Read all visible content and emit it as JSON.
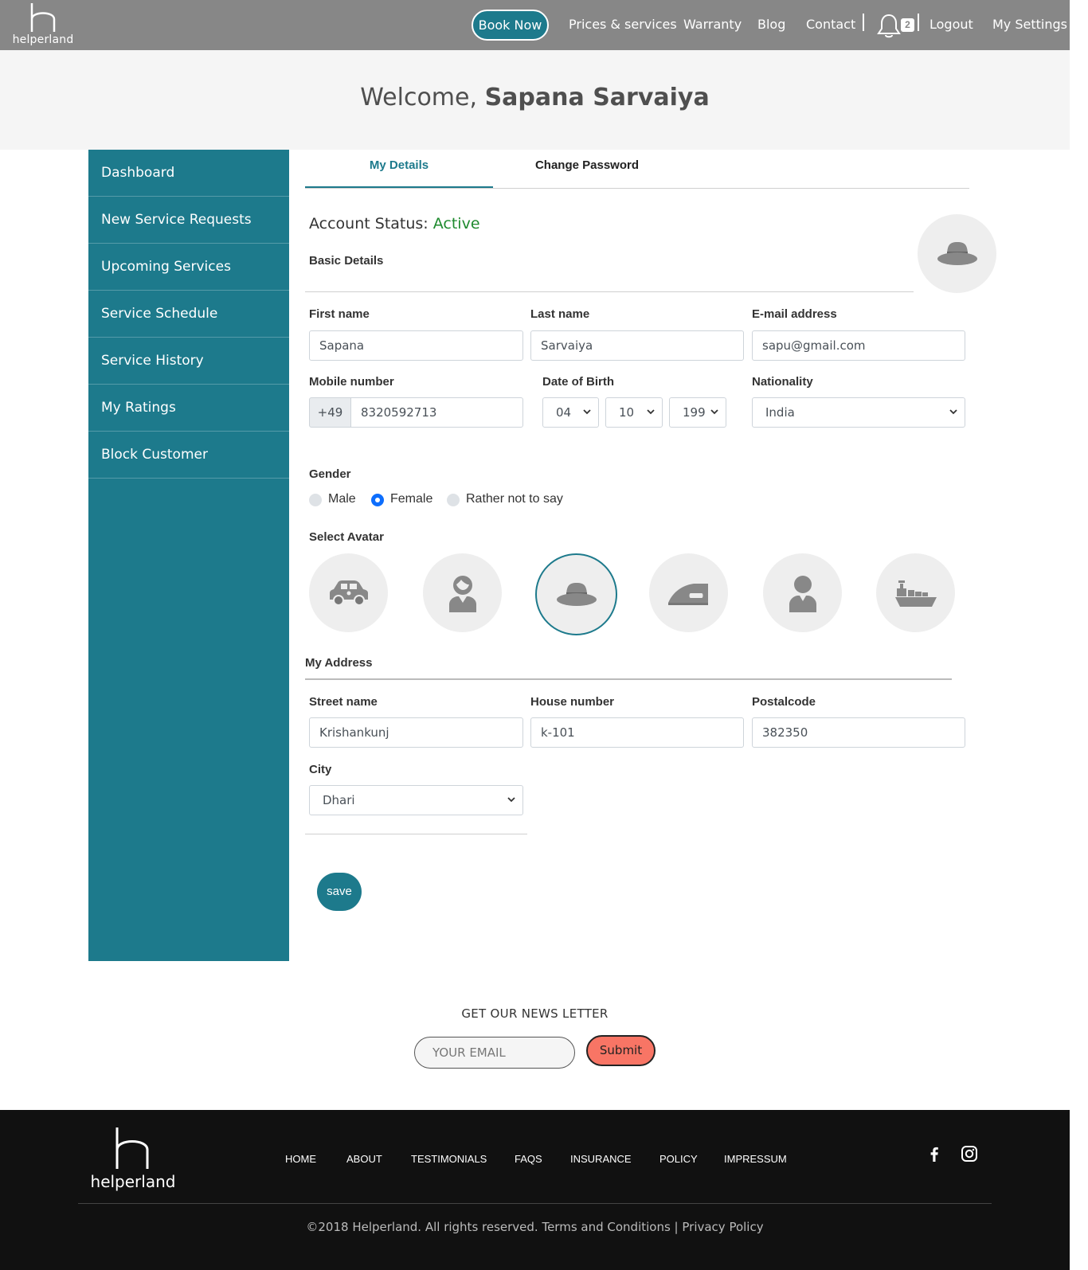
{
  "navbar": {
    "logo_text": "helperland",
    "book_now": "Book Now",
    "links": [
      "Prices & services",
      "Warranty",
      "Blog",
      "Contact"
    ],
    "notification_count": "2",
    "logout": "Logout",
    "settings": "My Settings"
  },
  "welcome": {
    "prefix": "Welcome, ",
    "name": "Sapana Sarvaiya"
  },
  "sidebar": {
    "items": [
      {
        "label": "Dashboard"
      },
      {
        "label": "New Service Requests"
      },
      {
        "label": "Upcoming Services"
      },
      {
        "label": "Service Schedule"
      },
      {
        "label": "Service History"
      },
      {
        "label": "My Ratings"
      },
      {
        "label": "Block Customer"
      }
    ]
  },
  "tabs": {
    "active": "My Details",
    "inactive": "Change Password"
  },
  "account": {
    "label": "Account Status: ",
    "status": "Active",
    "status_color": "#1e8a2e"
  },
  "basic": {
    "title": "Basic Details",
    "first_name": {
      "label": "First name",
      "value": "Sapana"
    },
    "last_name": {
      "label": "Last name",
      "value": "Sarvaiya"
    },
    "email": {
      "label": "E-mail address",
      "value": "sapu@gmail.com"
    },
    "mobile": {
      "label": "Mobile number",
      "prefix": "+49",
      "value": "8320592713"
    },
    "dob": {
      "label": "Date of Birth",
      "day": "04",
      "month": "10",
      "year": "199"
    },
    "nationality": {
      "label": "Nationality",
      "value": "India"
    }
  },
  "gender": {
    "label": "Gender",
    "options": [
      "Male",
      "Female",
      "Rather not to say"
    ],
    "selected": "Female"
  },
  "avatar": {
    "label": "Select Avatar",
    "options": [
      "car-icon",
      "female-user-icon",
      "hat-icon",
      "iron-icon",
      "male-user-icon",
      "ship-icon"
    ],
    "selected": "hat-icon"
  },
  "address": {
    "title": "My Address",
    "street": {
      "label": "Street name",
      "value": "Krishankunj"
    },
    "house": {
      "label": "House number",
      "value": "k-101"
    },
    "postal": {
      "label": "Postalcode",
      "value": "382350"
    },
    "city": {
      "label": "City",
      "value": "Dhari"
    }
  },
  "save_label": "save",
  "newsletter": {
    "title": "GET OUR NEWS LETTER",
    "placeholder": "YOUR EMAIL",
    "submit": "Submit"
  },
  "footer": {
    "logo_text": "helperland",
    "links": [
      "HOME",
      "ABOUT",
      "TESTIMONIALS",
      "FAQS",
      "INSURANCE",
      "POLICY",
      "IMPRESSUM"
    ],
    "copyright": "©2018 Helperland. All rights reserved. Terms and Conditions | Privacy Policy"
  },
  "colors": {
    "accent": "#1d7a8c",
    "navbar": "#878787",
    "footer": "#111111",
    "submit": "#f87565"
  }
}
